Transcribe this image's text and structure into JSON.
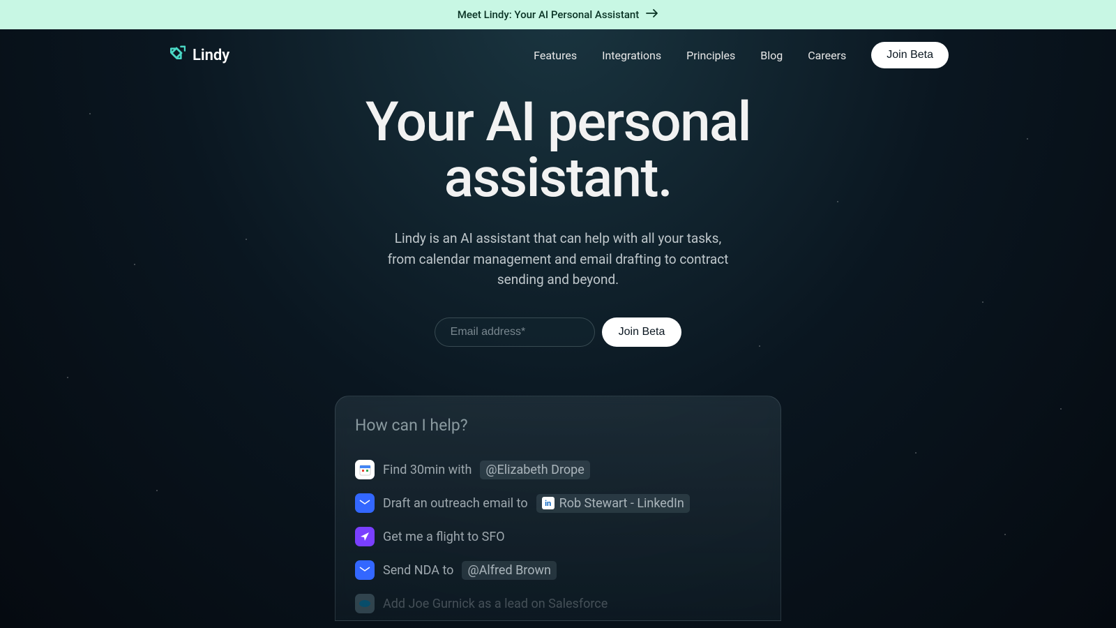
{
  "announcement": {
    "text": "Meet Lindy: Your AI Personal Assistant"
  },
  "brand": {
    "name": "Lindy"
  },
  "nav": {
    "links": [
      "Features",
      "Integrations",
      "Principles",
      "Blog",
      "Careers"
    ],
    "cta": "Join Beta"
  },
  "hero": {
    "title_line1": "Your AI personal",
    "title_line2": "assistant.",
    "subtitle_line1": "Lindy is an AI assistant that can help with all your tasks,",
    "subtitle_line2": "from calendar management and email drafting to contract",
    "subtitle_line3": "sending and beyond."
  },
  "form": {
    "placeholder": "Email address*",
    "submit": "Join Beta"
  },
  "demo": {
    "heading": "How can I help?",
    "suggestions": [
      {
        "icon": "calendar",
        "prefix": "Find 30min with",
        "mention": "@Elizabeth Drope"
      },
      {
        "icon": "mail",
        "prefix": "Draft an outreach email to",
        "mention": "Rob Stewart - LinkedIn",
        "mention_type": "linkedin"
      },
      {
        "icon": "plane",
        "prefix": "Get me a flight to SFO"
      },
      {
        "icon": "mail",
        "prefix": "Send NDA to",
        "mention": "@Alfred Brown"
      },
      {
        "icon": "salesforce",
        "prefix": "Add Joe Gurnick as a lead on Salesforce",
        "faded": true
      }
    ]
  }
}
